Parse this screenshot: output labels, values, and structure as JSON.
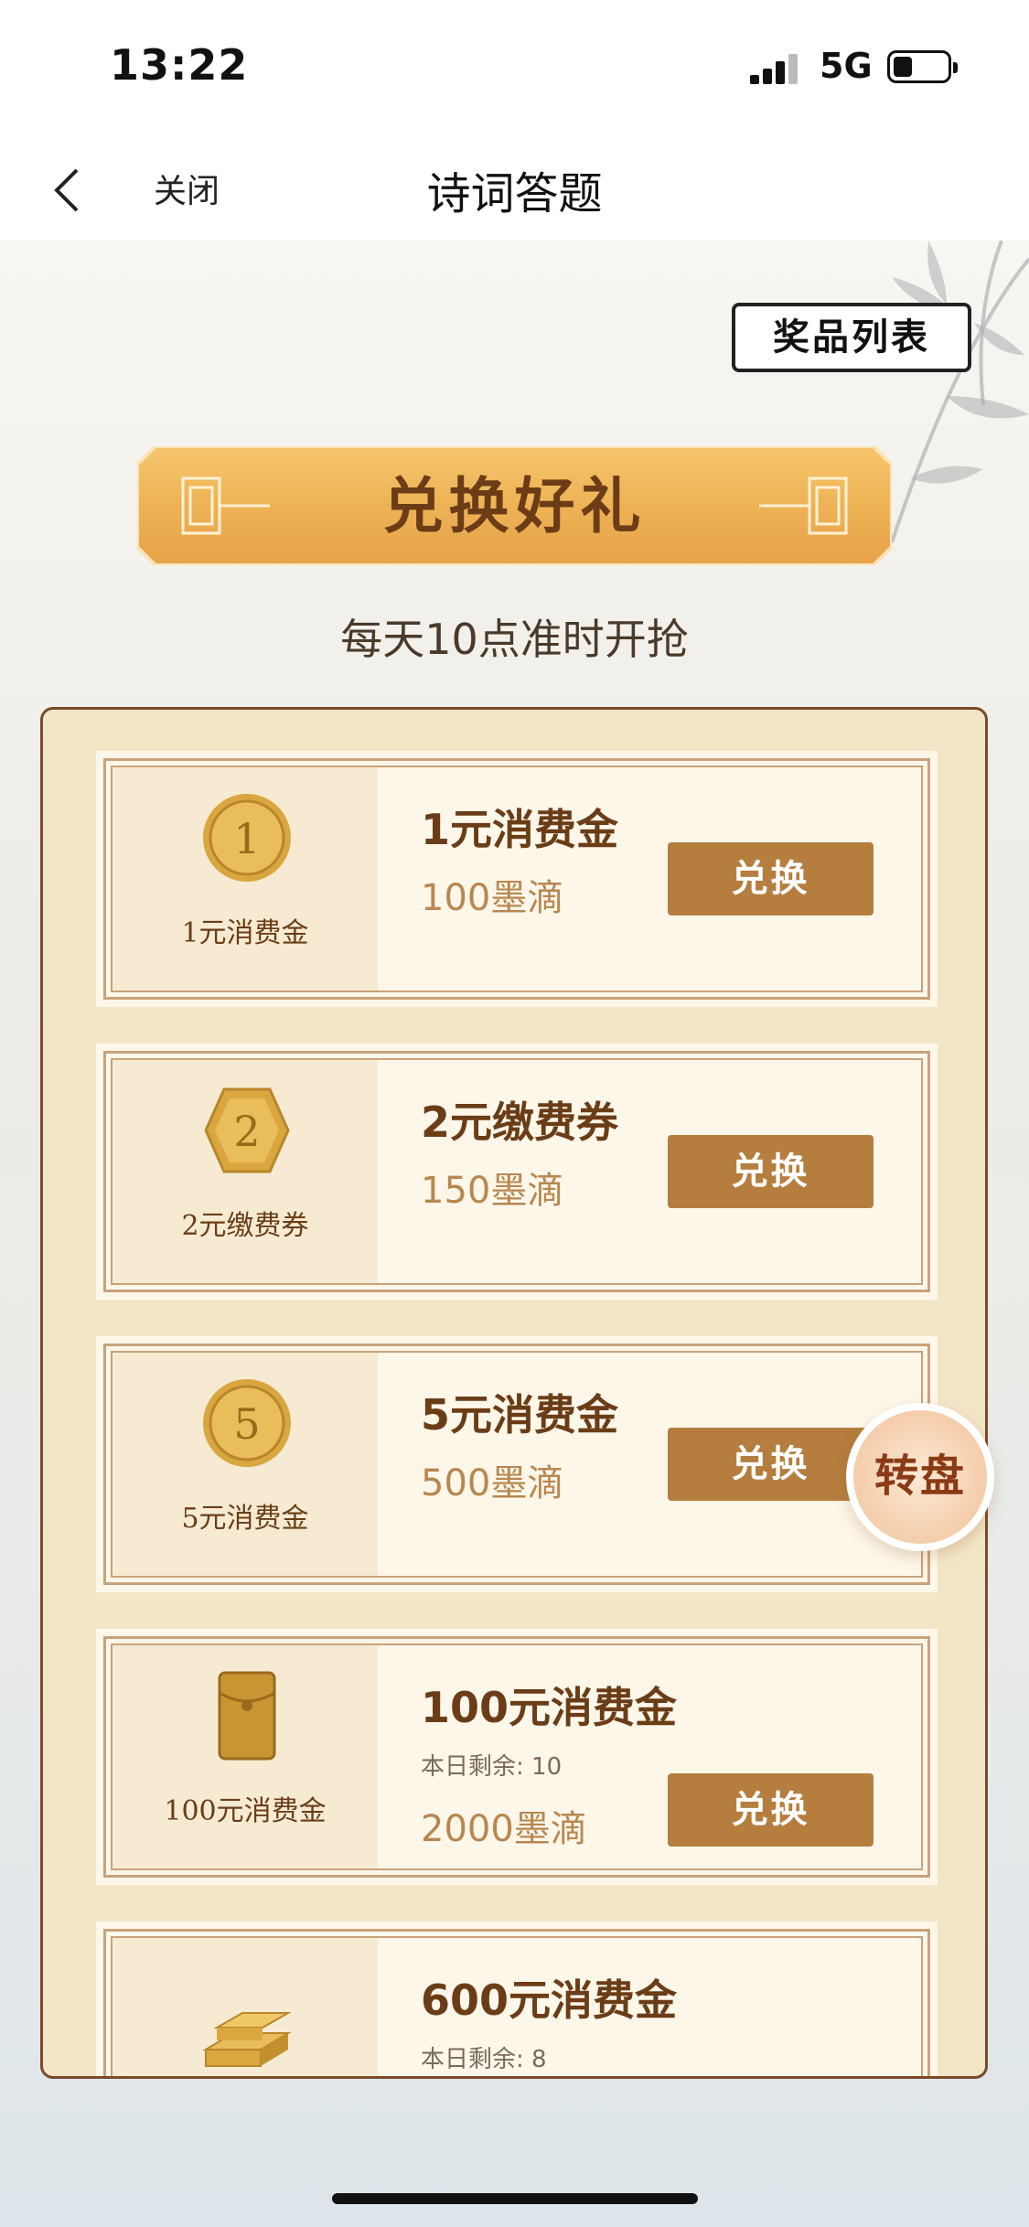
{
  "status_bar": {
    "time": "13:22",
    "network": "5G"
  },
  "nav": {
    "close_label": "关闭",
    "title": "诗词答题"
  },
  "header": {
    "prize_list_label": "奖品列表",
    "banner_title": "兑换好礼",
    "subtitle": "每天10点准时开抢"
  },
  "items": [
    {
      "icon_label": "1元消费金",
      "name": "1元消费金",
      "price": "100墨滴",
      "button": "兑换"
    },
    {
      "icon_label": "2元缴费券",
      "name": "2元缴费券",
      "price": "150墨滴",
      "button": "兑换"
    },
    {
      "icon_label": "5元消费金",
      "name": "5元消费金",
      "price": "500墨滴",
      "button": "兑换"
    },
    {
      "icon_label": "100元消费金",
      "name": "100元消费金",
      "remaining": "本日剩余: 10",
      "price": "2000墨滴",
      "button": "兑换"
    },
    {
      "icon_label": "",
      "name": "600元消费金",
      "remaining": "本日剩余: 8"
    }
  ],
  "floating": {
    "wheel_label": "转盘"
  },
  "colors": {
    "accent": "#b57e3e",
    "title_brown": "#6b3d17",
    "price": "#b8874f",
    "panel": "#f3e6c7"
  }
}
